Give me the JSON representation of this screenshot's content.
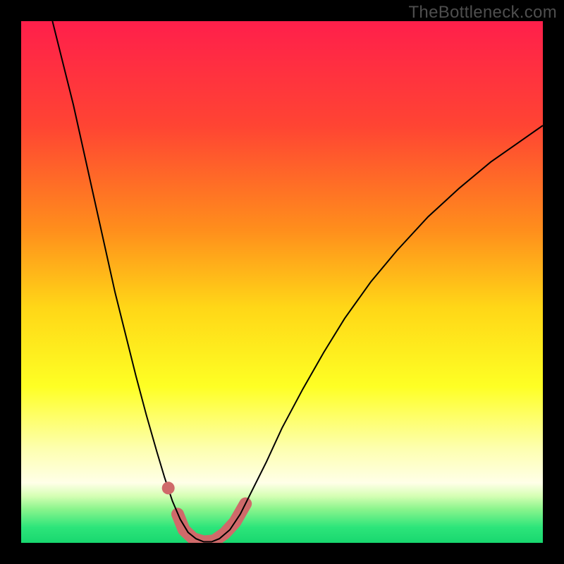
{
  "watermark": "TheBottleneck.com",
  "chart_data": {
    "type": "line",
    "title": "",
    "xlabel": "",
    "ylabel": "",
    "xlim": [
      0,
      100
    ],
    "ylim": [
      0,
      100
    ],
    "background_gradient_stops": [
      {
        "offset": 0.0,
        "color": "#ff1f4b"
      },
      {
        "offset": 0.2,
        "color": "#ff4433"
      },
      {
        "offset": 0.4,
        "color": "#ff8e1c"
      },
      {
        "offset": 0.55,
        "color": "#ffd717"
      },
      {
        "offset": 0.7,
        "color": "#feff24"
      },
      {
        "offset": 0.82,
        "color": "#fdffb0"
      },
      {
        "offset": 0.885,
        "color": "#ffffe8"
      },
      {
        "offset": 0.91,
        "color": "#d6ffb4"
      },
      {
        "offset": 0.935,
        "color": "#8bf58d"
      },
      {
        "offset": 0.97,
        "color": "#2de57a"
      },
      {
        "offset": 1.0,
        "color": "#18d76f"
      }
    ],
    "series": [
      {
        "name": "bottleneck-curve",
        "stroke": "#000000",
        "stroke_width": 2,
        "points": [
          {
            "x": 6.0,
            "y": 100.0
          },
          {
            "x": 8.0,
            "y": 92.0
          },
          {
            "x": 10.0,
            "y": 84.0
          },
          {
            "x": 12.0,
            "y": 75.0
          },
          {
            "x": 14.0,
            "y": 66.0
          },
          {
            "x": 16.0,
            "y": 57.0
          },
          {
            "x": 18.0,
            "y": 48.0
          },
          {
            "x": 20.0,
            "y": 40.0
          },
          {
            "x": 22.0,
            "y": 32.0
          },
          {
            "x": 24.0,
            "y": 24.5
          },
          {
            "x": 26.0,
            "y": 17.5
          },
          {
            "x": 27.5,
            "y": 12.5
          },
          {
            "x": 29.0,
            "y": 8.0
          },
          {
            "x": 30.5,
            "y": 4.5
          },
          {
            "x": 32.0,
            "y": 2.0
          },
          {
            "x": 33.5,
            "y": 0.8
          },
          {
            "x": 35.0,
            "y": 0.2
          },
          {
            "x": 36.5,
            "y": 0.2
          },
          {
            "x": 38.0,
            "y": 0.8
          },
          {
            "x": 40.0,
            "y": 2.5
          },
          {
            "x": 42.0,
            "y": 5.5
          },
          {
            "x": 44.0,
            "y": 9.5
          },
          {
            "x": 47.0,
            "y": 15.5
          },
          {
            "x": 50.0,
            "y": 22.0
          },
          {
            "x": 54.0,
            "y": 29.5
          },
          {
            "x": 58.0,
            "y": 36.5
          },
          {
            "x": 62.0,
            "y": 43.0
          },
          {
            "x": 67.0,
            "y": 50.0
          },
          {
            "x": 72.0,
            "y": 56.0
          },
          {
            "x": 78.0,
            "y": 62.5
          },
          {
            "x": 84.0,
            "y": 68.0
          },
          {
            "x": 90.0,
            "y": 73.0
          },
          {
            "x": 95.0,
            "y": 76.5
          },
          {
            "x": 100.0,
            "y": 80.0
          }
        ]
      },
      {
        "name": "highlight-band",
        "stroke": "#cf6a6a",
        "stroke_width": 18,
        "linecap": "round",
        "points": [
          {
            "x": 30.0,
            "y": 5.5
          },
          {
            "x": 31.2,
            "y": 2.5
          },
          {
            "x": 33.0,
            "y": 0.8
          },
          {
            "x": 35.0,
            "y": 0.2
          },
          {
            "x": 37.0,
            "y": 0.4
          },
          {
            "x": 39.0,
            "y": 1.8
          },
          {
            "x": 41.0,
            "y": 4.0
          },
          {
            "x": 43.0,
            "y": 7.5
          }
        ]
      }
    ],
    "markers": [
      {
        "name": "highlight-dot",
        "x": 28.2,
        "y": 10.5,
        "r": 9,
        "fill": "#cf6a6a"
      }
    ]
  }
}
